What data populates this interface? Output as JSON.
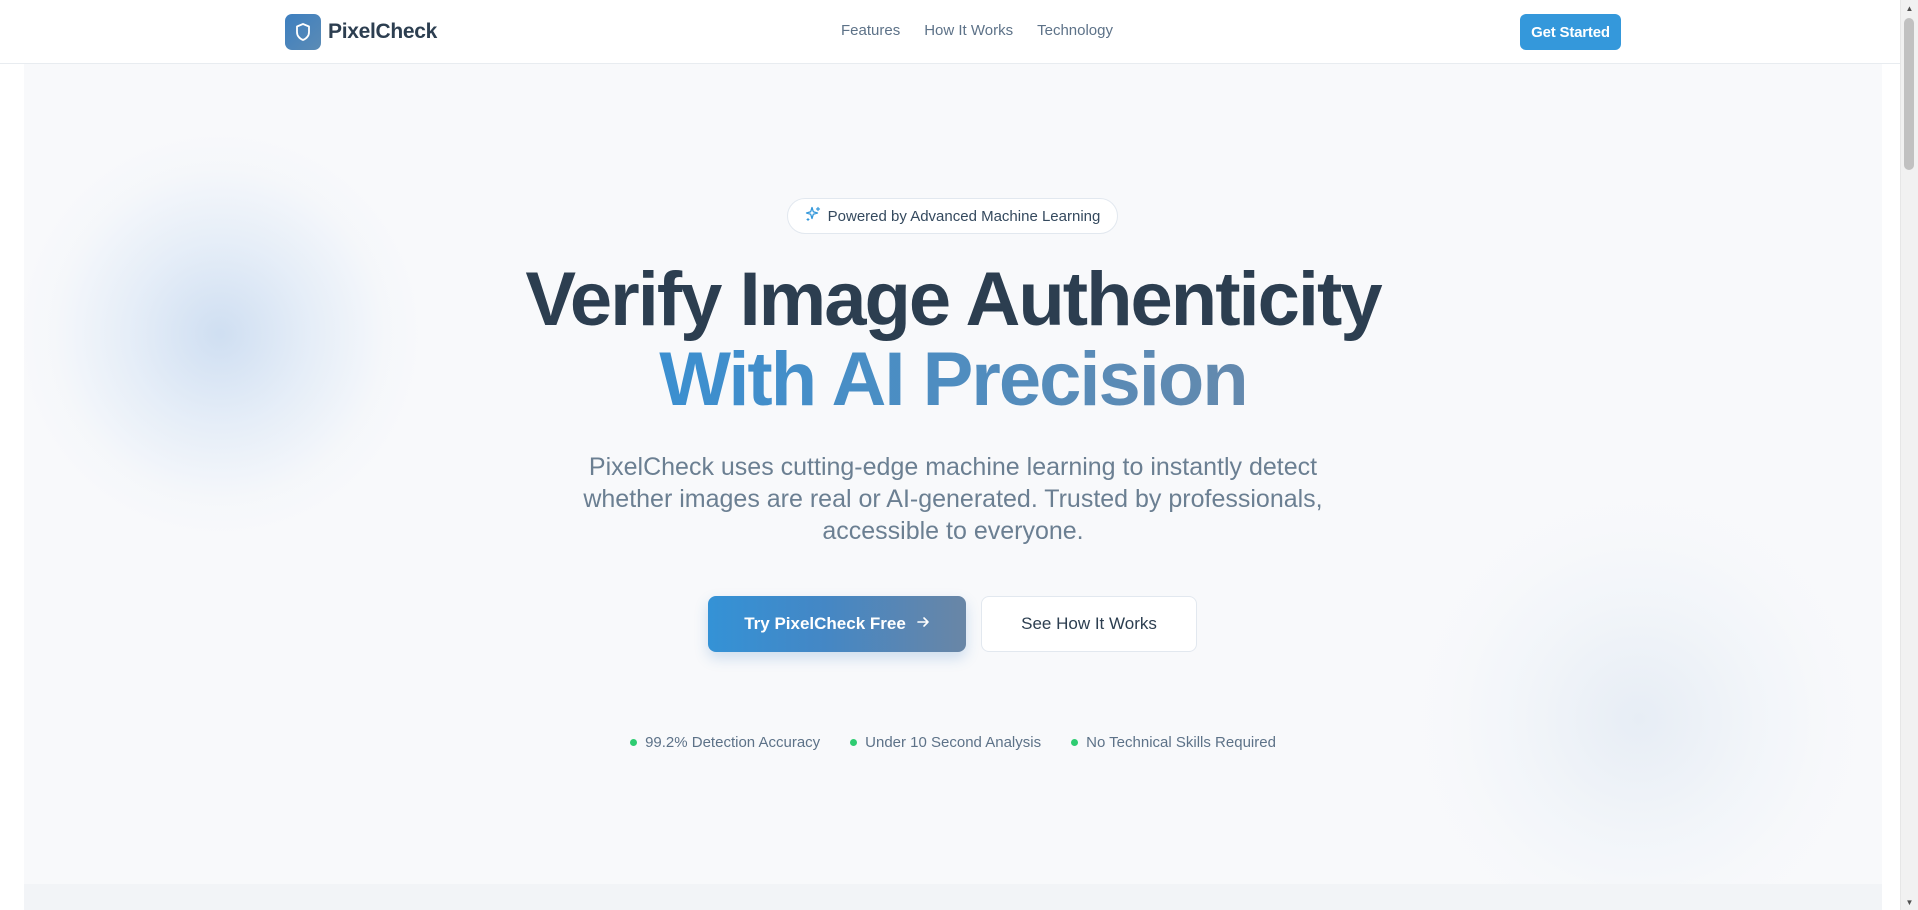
{
  "brand": {
    "name": "PixelCheck",
    "logo_icon": "shield-icon"
  },
  "nav": {
    "links": [
      {
        "label": "Features"
      },
      {
        "label": "How It Works"
      },
      {
        "label": "Technology"
      }
    ],
    "cta_label": "Get Started"
  },
  "hero": {
    "badge": {
      "icon": "sparkles-icon",
      "text": "Powered by Advanced Machine Learning"
    },
    "headline_line1": "Verify Image Authenticity",
    "headline_line2": "With AI Precision",
    "subtext": "PixelCheck uses cutting-edge machine learning to instantly detect whether images are real or AI-generated. Trusted by professionals, accessible to everyone.",
    "primary_button": {
      "label": "Try PixelCheck Free",
      "icon": "arrow-right-icon"
    },
    "secondary_button": {
      "label": "See How It Works"
    },
    "stats": [
      {
        "text": "99.2% Detection Accuracy"
      },
      {
        "text": "Under 10 Second Analysis"
      },
      {
        "text": "No Technical Skills Required"
      }
    ]
  },
  "colors": {
    "primary": "#3498db",
    "heading": "#2c3e50",
    "gradient_start": "#3b8fd0",
    "gradient_end": "#6489ad",
    "stat_dot": "#2ecc71",
    "body_text": "#6b7f92"
  }
}
